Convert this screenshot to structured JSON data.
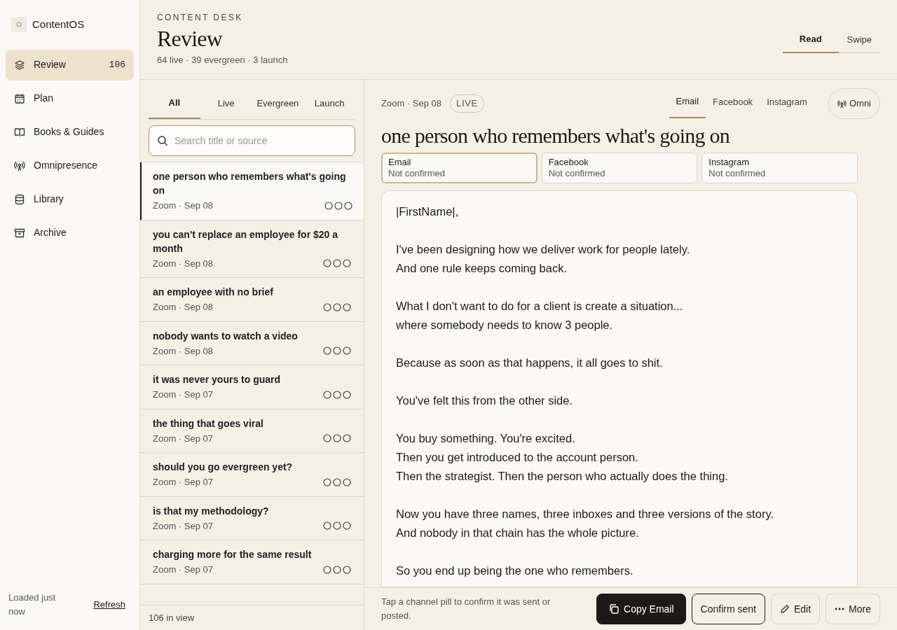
{
  "app": {
    "name": "ContentOS"
  },
  "nav": [
    {
      "label": "Review",
      "kind": "layers",
      "count": "106",
      "selected": true
    },
    {
      "label": "Plan",
      "kind": "calendar",
      "selected": false
    },
    {
      "label": "Books & Guides",
      "kind": "book",
      "selected": false
    },
    {
      "label": "Omnipresence",
      "kind": "broadcast",
      "selected": false
    },
    {
      "label": "Library",
      "kind": "database",
      "selected": false
    },
    {
      "label": "Archive",
      "kind": "archive",
      "selected": false
    }
  ],
  "sidebar_footer": {
    "status": "Loaded just now",
    "refresh": "Refresh"
  },
  "header": {
    "eyebrow": "CONTENT DESK",
    "title": "Review",
    "summary": "64 live · 39 evergreen · 3 launch",
    "modes": [
      {
        "label": "Read",
        "selected": true
      },
      {
        "label": "Swipe",
        "selected": false
      }
    ]
  },
  "filters": [
    {
      "label": "All",
      "selected": true
    },
    {
      "label": "Live",
      "selected": false
    },
    {
      "label": "Evergreen",
      "selected": false
    },
    {
      "label": "Launch",
      "selected": false
    }
  ],
  "search": {
    "placeholder": "Search title or source"
  },
  "items": [
    {
      "title": "one person who remembers what's going on",
      "meta": "Zoom · Sep 08",
      "selected": true
    },
    {
      "title": "you can't replace an employee for $20 a month",
      "meta": "Zoom · Sep 08",
      "selected": false
    },
    {
      "title": "an employee with no brief",
      "meta": "Zoom · Sep 08",
      "selected": false
    },
    {
      "title": "nobody wants to watch a video",
      "meta": "Zoom · Sep 08",
      "selected": false
    },
    {
      "title": "it was never yours to guard",
      "meta": "Zoom · Sep 07",
      "selected": false
    },
    {
      "title": "the thing that goes viral",
      "meta": "Zoom · Sep 07",
      "selected": false
    },
    {
      "title": "should you go evergreen yet?",
      "meta": "Zoom · Sep 07",
      "selected": false
    },
    {
      "title": "is that my methodology?",
      "meta": "Zoom · Sep 07",
      "selected": false
    },
    {
      "title": "charging more for the same result",
      "meta": "Zoom · Sep 07",
      "selected": false
    }
  ],
  "list_footer": "106 in view",
  "detail": {
    "meta": "Zoom · Sep 08",
    "badge": "LIVE",
    "channel_tabs": [
      {
        "label": "Email",
        "selected": true
      },
      {
        "label": "Facebook",
        "selected": false
      },
      {
        "label": "Instagram",
        "selected": false
      }
    ],
    "omni_button": "Omni",
    "title": "one person who remembers what's going on",
    "pills": [
      {
        "channel": "Email",
        "status": "Not confirmed",
        "selected": true
      },
      {
        "channel": "Facebook",
        "status": "Not confirmed",
        "selected": false
      },
      {
        "channel": "Instagram",
        "status": "Not confirmed",
        "selected": false
      }
    ],
    "body": [
      [
        "|FirstName|,"
      ],
      [
        "I've been designing how we deliver work for people lately.",
        "And one rule keeps coming back."
      ],
      [
        "What I don't want to do for a client is create a situation...",
        "where somebody needs to know 3 people."
      ],
      [
        "Because as soon as that happens, it all goes to shit."
      ],
      [
        "You've felt this from the other side."
      ],
      [
        "You buy something. You're excited.",
        "Then you get introduced to the account person.",
        "Then the strategist. Then the person who actually does the thing."
      ],
      [
        "Now you have three names, three inboxes and three versions of the story.",
        "And nobody in that chain has the whole picture."
      ],
      [
        "So you end up being the one who remembers."
      ]
    ],
    "hint": "Tap a channel pill to confirm it was sent or posted.",
    "actions": [
      {
        "label": "Copy Email",
        "kind": "primary"
      },
      {
        "label": "Confirm sent",
        "kind": "outline"
      },
      {
        "label": "Edit",
        "kind": "edit"
      },
      {
        "label": "More",
        "kind": "more"
      }
    ]
  }
}
